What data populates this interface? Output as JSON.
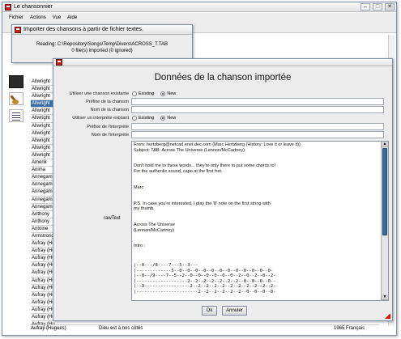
{
  "main": {
    "title": "Le chansonnier",
    "menus": [
      "Fichier",
      "Actions",
      "Vue",
      "Aide"
    ],
    "left_list": [
      "Allwright",
      "Allwright",
      "Allwright",
      "Allwright",
      "Allwright",
      "Allwright",
      "Allwright",
      "Allwright",
      "Allwright",
      "Allwright",
      "Allwright",
      "Amerik",
      "Anima",
      "Annegam",
      "Annegam",
      "Annegam",
      "Annegam",
      "Annegam",
      "Anthony",
      "Anthony",
      "Antoine",
      "Armstrong",
      "Aufray (Hu",
      "Aufray (Hu",
      "Aufray (Hu",
      "Aufray (Hu",
      "Aufray (Hu",
      "Aufray (Hu",
      "Aufray (Hu",
      "Aufray (Hu",
      "Aufray (Hu",
      "Aufray (Hu",
      "Aufray (Hu",
      "Aufray (Hu"
    ],
    "selected_index": 3,
    "bottom_row": {
      "artist": "Aufray (Hugues)",
      "song": "Dieu est à nos côtés",
      "extra": "1965 Français"
    }
  },
  "import": {
    "title": "Importer des chansons à partir de fichier textes.",
    "reading": "Reading: C:\\Repository\\Songs\\Temp\\Divers\\ACROSS_T.TAB",
    "status": "0 file(s) imported (0 ignored)"
  },
  "dialog": {
    "title": "Données de la chanson importée",
    "song_choice_label": "Utiliser une chanson existante",
    "existing": "Existing",
    "new": "New",
    "song_prefix_label": "Préfixe de la chanson",
    "song_name_label": "Nom de la chanson",
    "performer_choice_label": "Utiliser un interprète existant",
    "performer_prefix_label": "Préfixe de l'interprète",
    "performer_name_label": "Nom de l'interprète",
    "raw_label": "rawText",
    "raw_text": "From: hertzberg@netcad.enet.dec.com (Marc Hertzberg (History: Love it or leave it))\nSubject: TAB: Across The Universe (Lennon/McCartney)\n\n\nDon't hold me to these words... they're only there to put some chords to!\nFor the authentic sound, capo at the first fret.\n\n\nMarc\n\n\nP.S. In case you're interested, I play the '8' note on the first string with\nmy thumb.\n\n\nAcross The Universe\n(Lennon/McCartney)\n\n\nIntro :\n",
    "tab_text": "|--0---/8----7---5--3---\n|-------------5--0--0--0--0--0--0--0--0--0--0--0--0-\n|--0--/9----7--5--2--0--0--0--0--0--0--2--0--2--0--2-\n|-------------------2--2--2--2--2--2--2--0--0--0--0--\n|--3-----------------2--2--2--2--2--2--2--2--2--2--2-\n|-----------------------2--2--2--2--2--2--0--0--0--0-",
    "ok": "Ok",
    "cancel": "Annuler"
  }
}
